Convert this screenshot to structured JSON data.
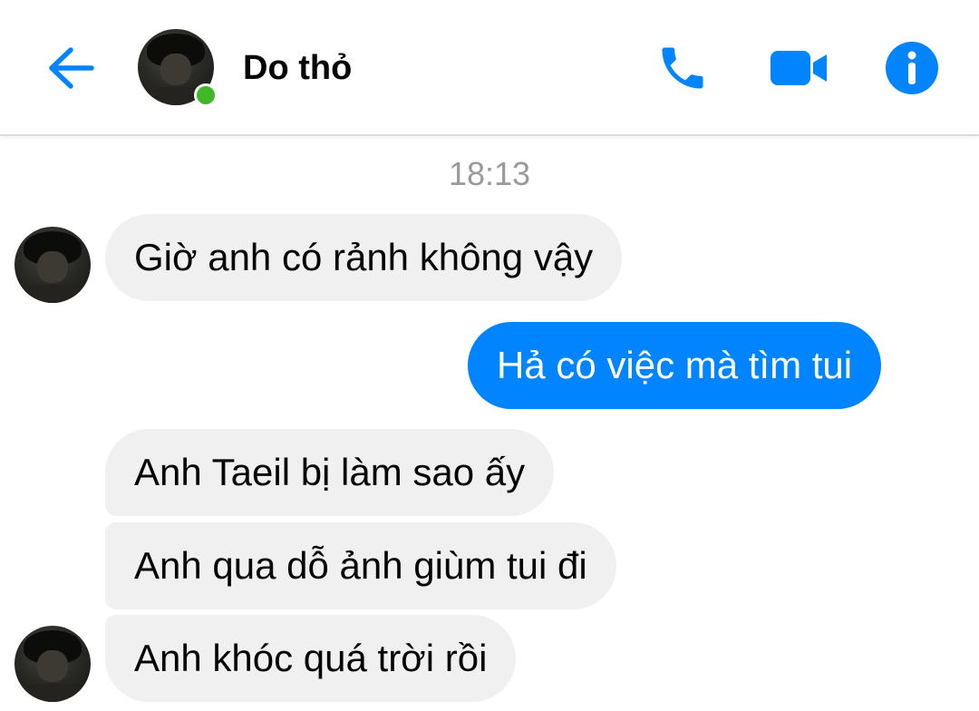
{
  "header": {
    "contact_name": "Do thỏ",
    "online": true,
    "icons": {
      "back": "arrow-left-icon",
      "call": "phone-icon",
      "video": "video-camera-icon",
      "info": "info-icon"
    },
    "accent_color": "#0084ff",
    "online_color": "#42b72a"
  },
  "conversation": {
    "timestamp": "18:13",
    "messages": [
      {
        "sender": "them",
        "text": "Giờ anh có rảnh không vậy"
      },
      {
        "sender": "me",
        "text": "Hả có việc mà tìm tui"
      },
      {
        "sender": "them",
        "text": "Anh Taeil bị làm sao ấy"
      },
      {
        "sender": "them",
        "text": "Anh qua dỗ ảnh giùm tui đi"
      },
      {
        "sender": "them",
        "text": "Anh khóc quá trời rồi"
      }
    ],
    "colors": {
      "incoming_bubble": "#f0f0f0",
      "outgoing_bubble": "#0084ff",
      "timestamp": "#9a9a9a"
    }
  }
}
